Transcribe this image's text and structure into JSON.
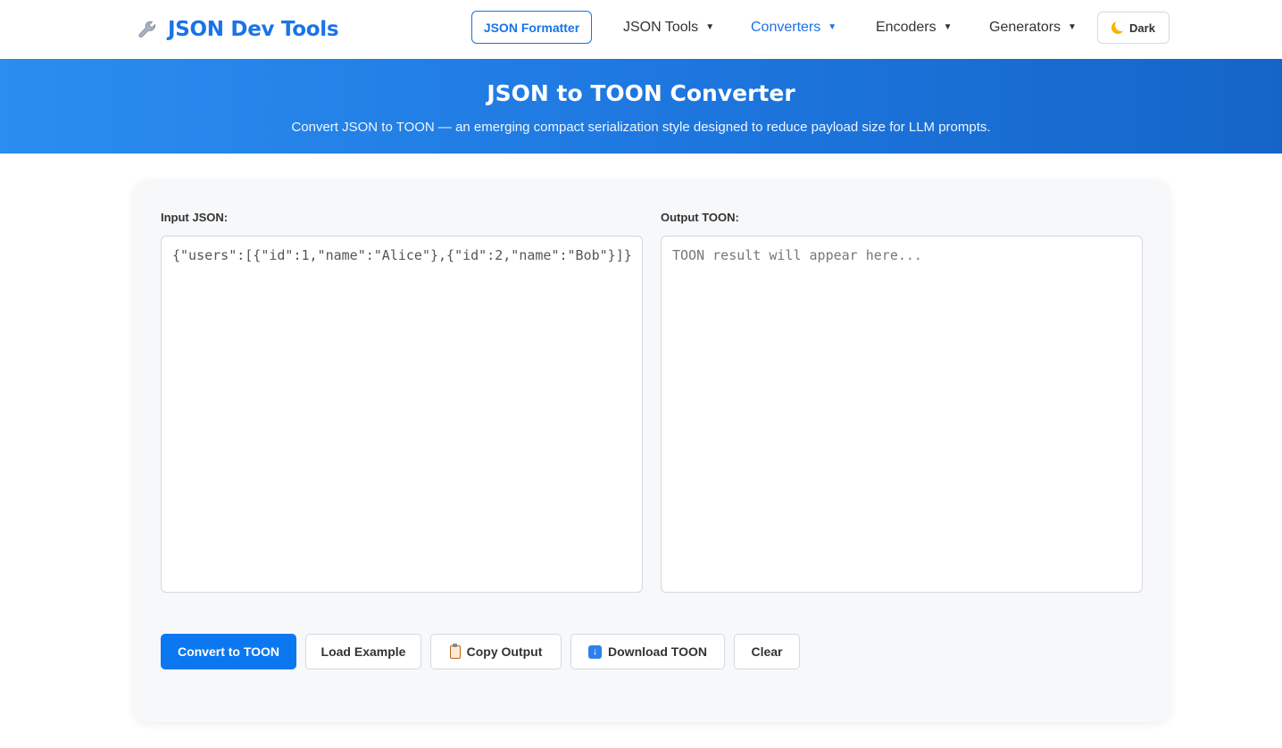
{
  "brand": {
    "title": "JSON Dev Tools",
    "icon": "wrench-icon"
  },
  "nav": {
    "formatter": "JSON Formatter",
    "items": [
      {
        "label": "JSON Tools",
        "caret": "▼"
      },
      {
        "label": "Converters",
        "caret": "▼"
      },
      {
        "label": "Encoders",
        "caret": "▼"
      },
      {
        "label": "Generators",
        "caret": "▼"
      }
    ],
    "active_item": "Converters",
    "theme_toggle": {
      "label": "Dark",
      "icon": "moon-icon"
    }
  },
  "hero": {
    "title": "JSON to TOON Converter",
    "subtitle": "Convert JSON to TOON — an emerging compact serialization style designed to reduce payload size for LLM prompts."
  },
  "input": {
    "label": "Input JSON:",
    "value": "{\"users\":[{\"id\":1,\"name\":\"Alice\"},{\"id\":2,\"name\":\"Bob\"}]}"
  },
  "output": {
    "label": "Output TOON:",
    "placeholder": "TOON result will appear here..."
  },
  "actions": {
    "convert": "Convert to TOON",
    "load_example": "Load Example",
    "copy_output": "Copy Output",
    "download": "Download TOON",
    "clear": "Clear"
  },
  "colors": {
    "accent": "#1a73e8",
    "primary_button": "#0b78f2",
    "hero_gradient_start": "#2b8df0",
    "hero_gradient_end": "#1565c8"
  }
}
